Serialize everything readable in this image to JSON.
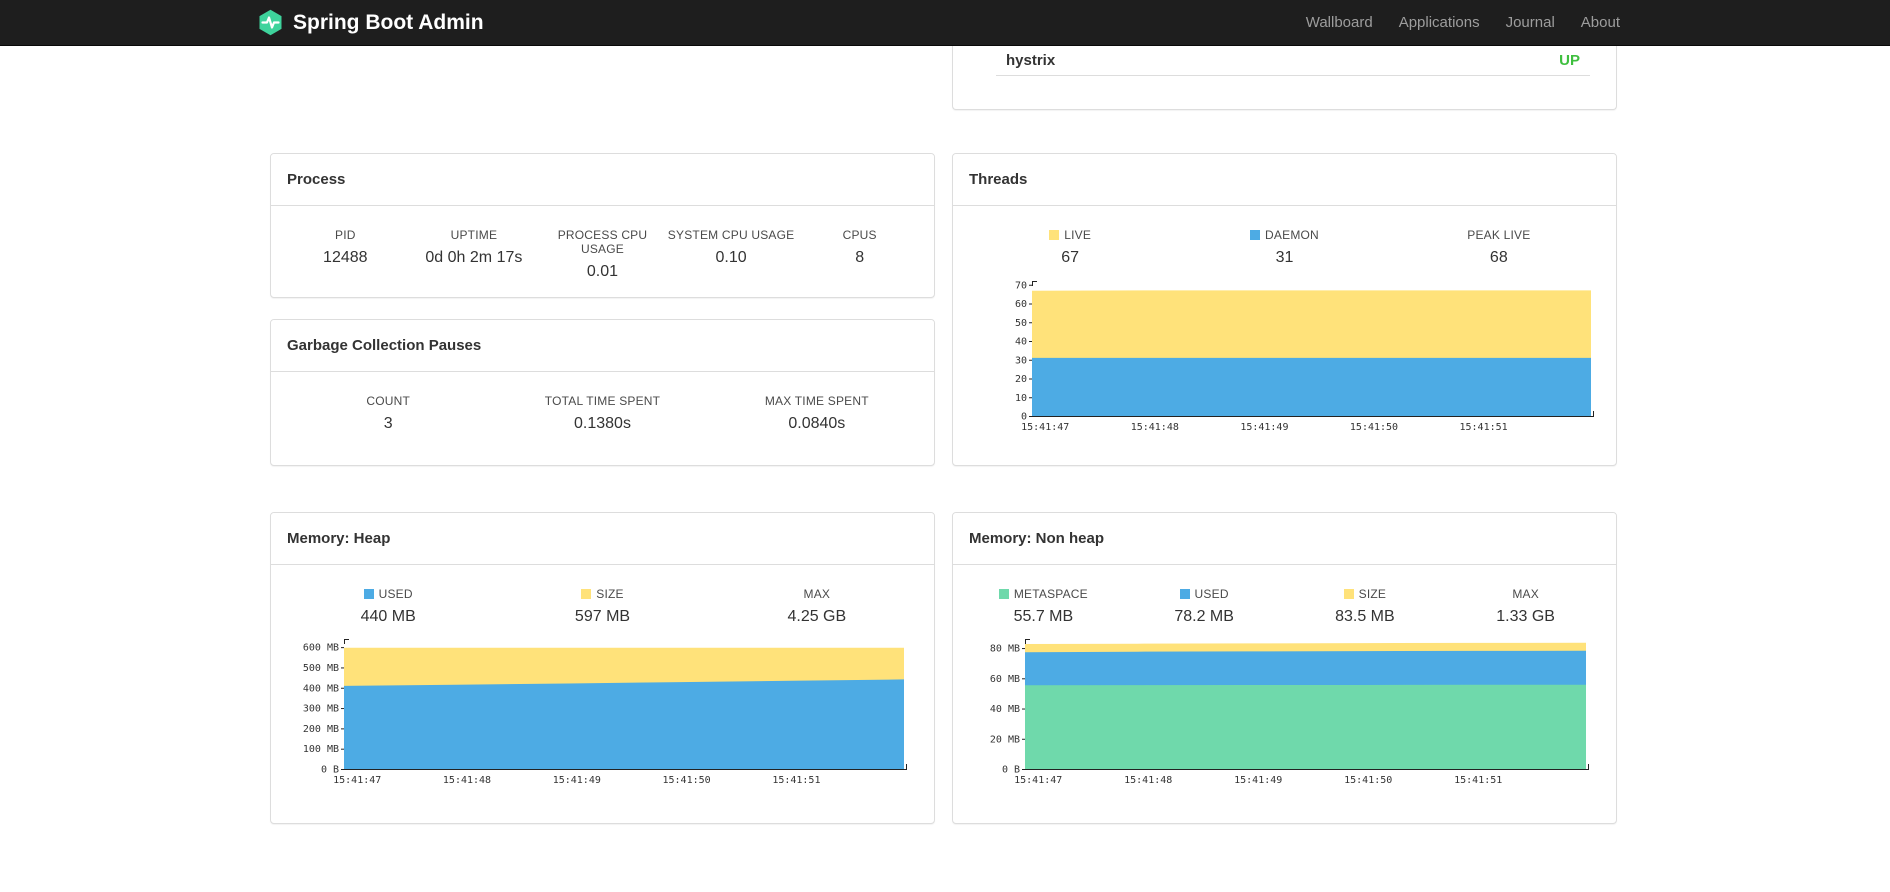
{
  "navbar": {
    "brand": "Spring Boot Admin",
    "items": [
      {
        "label": "Wallboard"
      },
      {
        "label": "Applications"
      },
      {
        "label": "Journal"
      },
      {
        "label": "About"
      }
    ]
  },
  "colors": {
    "navbar_bg": "#1e1e1e",
    "brand": "#3ed39c",
    "nav_link": "#9d9d9d",
    "status_up": "#3fbf3f",
    "chart_blue": "#4dabe4",
    "chart_yellow": "#ffe27a",
    "chart_green": "#6fd9ab"
  },
  "health": {
    "indicator": "hystrix",
    "status": "UP",
    "status_style": "color:#3fbf3f"
  },
  "process": {
    "title": "Process",
    "stats": [
      {
        "label": "PID",
        "value": "12488"
      },
      {
        "label": "UPTIME",
        "value": "0d 0h 2m 17s"
      },
      {
        "label": "PROCESS CPU USAGE",
        "value": "0.01"
      },
      {
        "label": "SYSTEM CPU USAGE",
        "value": "0.10"
      },
      {
        "label": "CPUS",
        "value": "8"
      }
    ]
  },
  "gc": {
    "title": "Garbage Collection Pauses",
    "stats": [
      {
        "label": "COUNT",
        "value": "3"
      },
      {
        "label": "TOTAL TIME SPENT",
        "value": "0.1380s"
      },
      {
        "label": "MAX TIME SPENT",
        "value": "0.0840s"
      }
    ]
  },
  "chart_data": [
    {
      "type": "area",
      "title": "Threads",
      "legend": [
        {
          "label": "LIVE",
          "value": "67",
          "swatch": "#ffe27a"
        },
        {
          "label": "DAEMON",
          "value": "31",
          "swatch": "#4dabe4"
        },
        {
          "label": "PEAK LIVE",
          "value": "68"
        }
      ],
      "ymax": 72,
      "yticks": [
        {
          "v": 0,
          "label": "0"
        },
        {
          "v": 10,
          "label": "10"
        },
        {
          "v": 20,
          "label": "20"
        },
        {
          "v": 30,
          "label": "30"
        },
        {
          "v": 40,
          "label": "40"
        },
        {
          "v": 50,
          "label": "50"
        },
        {
          "v": 60,
          "label": "60"
        },
        {
          "v": 70,
          "label": "70"
        }
      ],
      "xlabels": [
        "15:41:47",
        "15:41:48",
        "15:41:49",
        "15:41:50",
        "15:41:51"
      ],
      "x_intervals": 5.1,
      "series": [
        {
          "name": "LIVE",
          "color": "#ffe27a",
          "values": [
            66.8,
            67,
            67,
            67,
            67,
            67
          ]
        },
        {
          "name": "DAEMON",
          "color": "#4dabe4",
          "values": [
            31,
            31,
            31,
            31,
            31,
            31
          ]
        }
      ]
    },
    {
      "type": "area",
      "title": "Memory: Heap",
      "legend": [
        {
          "label": "USED",
          "value": "440 MB",
          "swatch": "#4dabe4"
        },
        {
          "label": "SIZE",
          "value": "597 MB",
          "swatch": "#ffe27a"
        },
        {
          "label": "MAX",
          "value": "4.25 GB"
        }
      ],
      "ymax": 640,
      "yticks": [
        {
          "v": 0,
          "label": "0 B"
        },
        {
          "v": 100,
          "label": "100 MB"
        },
        {
          "v": 200,
          "label": "200 MB"
        },
        {
          "v": 300,
          "label": "300 MB"
        },
        {
          "v": 400,
          "label": "400 MB"
        },
        {
          "v": 500,
          "label": "500 MB"
        },
        {
          "v": 600,
          "label": "600 MB"
        }
      ],
      "xlabels": [
        "15:41:47",
        "15:41:48",
        "15:41:49",
        "15:41:50",
        "15:41:51"
      ],
      "x_intervals": 5.1,
      "series": [
        {
          "name": "SIZE",
          "color": "#ffe27a",
          "values": [
            597,
            597,
            597,
            597,
            597,
            597
          ]
        },
        {
          "name": "USED",
          "color": "#4dabe4",
          "values": [
            409,
            415,
            421,
            428,
            434,
            441
          ]
        }
      ]
    },
    {
      "type": "area",
      "title": "Memory: Non heap",
      "legend": [
        {
          "label": "METASPACE",
          "value": "55.7 MB",
          "swatch": "#6fd9ab"
        },
        {
          "label": "USED",
          "value": "78.2 MB",
          "swatch": "#4dabe4"
        },
        {
          "label": "SIZE",
          "value": "83.5 MB",
          "swatch": "#ffe27a"
        },
        {
          "label": "MAX",
          "value": "1.33 GB"
        }
      ],
      "ymax": 86,
      "yticks": [
        {
          "v": 0,
          "label": "0 B"
        },
        {
          "v": 20,
          "label": "20 MB"
        },
        {
          "v": 40,
          "label": "40 MB"
        },
        {
          "v": 60,
          "label": "60 MB"
        },
        {
          "v": 80,
          "label": "80 MB"
        }
      ],
      "xlabels": [
        "15:41:47",
        "15:41:48",
        "15:41:49",
        "15:41:50",
        "15:41:51"
      ],
      "x_intervals": 5.1,
      "series": [
        {
          "name": "SIZE",
          "color": "#ffe27a",
          "values": [
            82.7,
            82.9,
            83.1,
            83.3,
            83.4,
            83.5
          ]
        },
        {
          "name": "USED",
          "color": "#4dabe4",
          "values": [
            77.3,
            77.6,
            77.8,
            78.0,
            78.1,
            78.2
          ]
        },
        {
          "name": "METASPACE",
          "color": "#6fd9ab",
          "values": [
            55.4,
            55.5,
            55.6,
            55.6,
            55.7,
            55.7
          ]
        }
      ]
    }
  ]
}
